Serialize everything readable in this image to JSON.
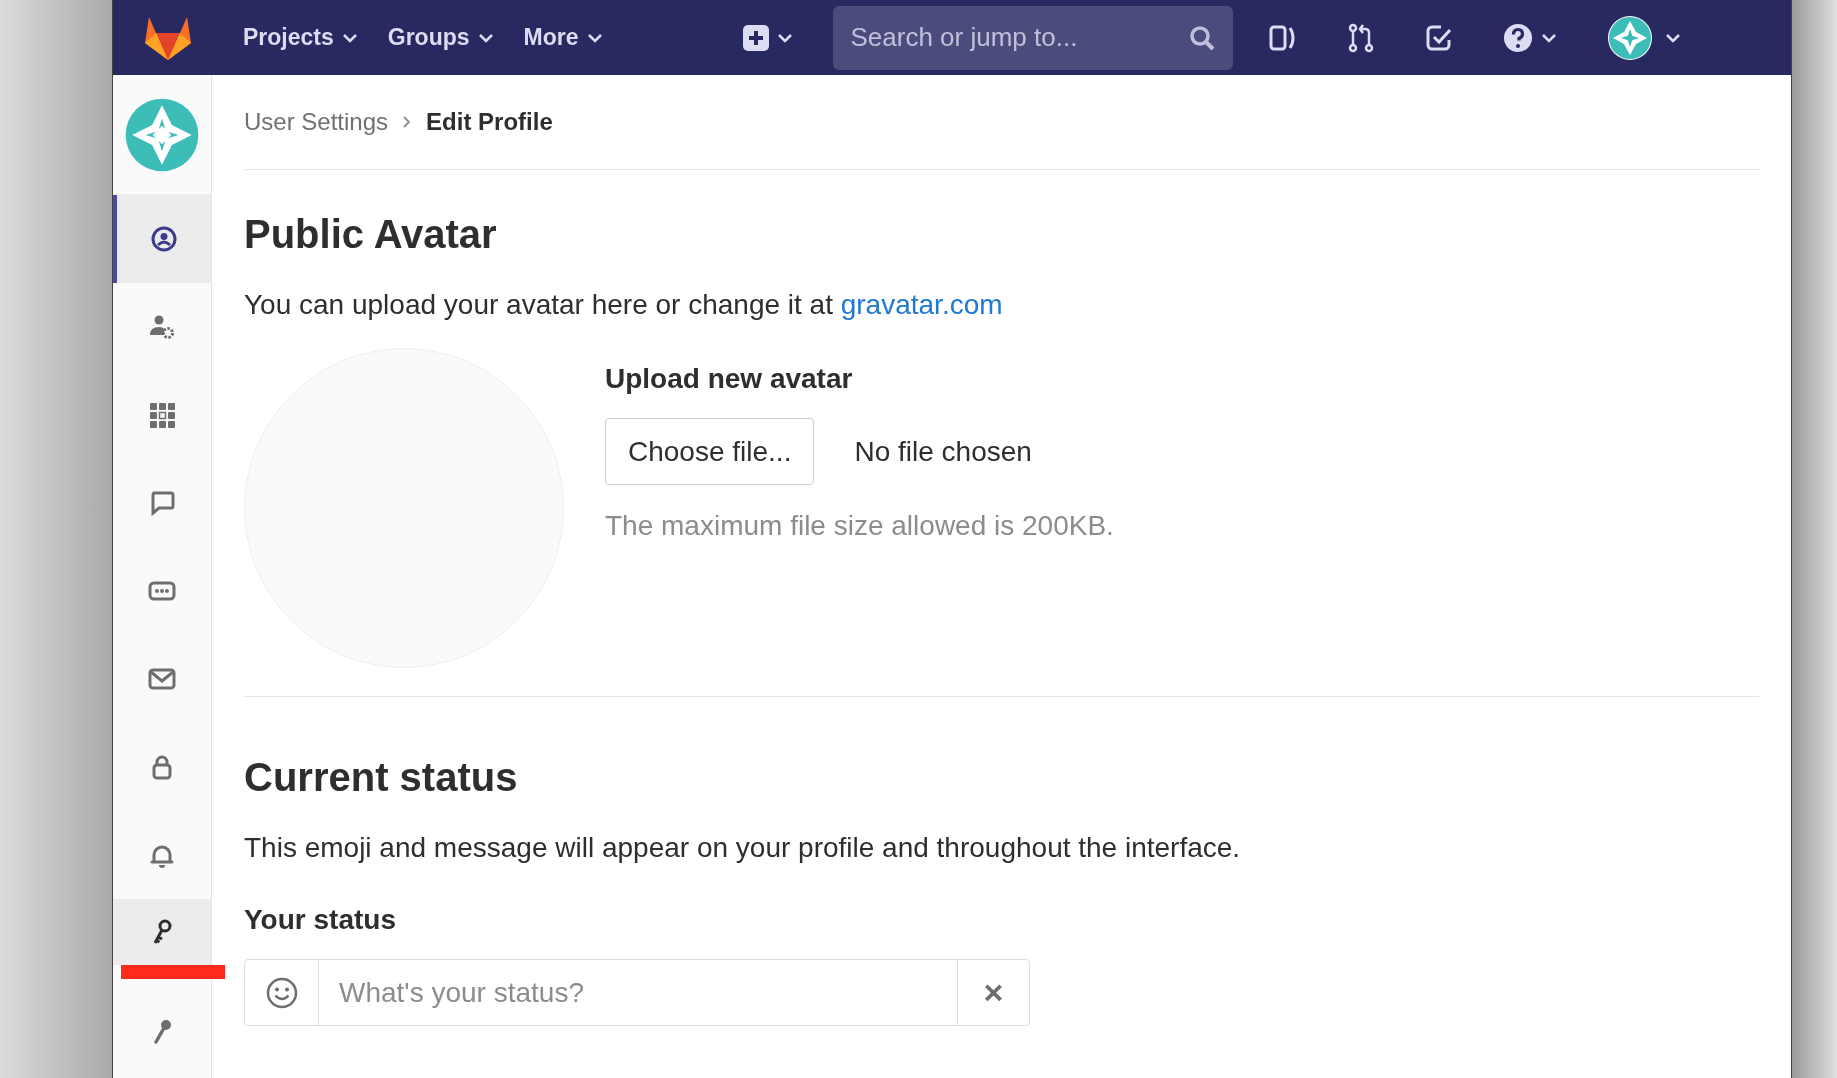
{
  "navbar": {
    "menus": [
      {
        "label": "Projects"
      },
      {
        "label": "Groups"
      },
      {
        "label": "More"
      }
    ],
    "search": {
      "placeholder": "Search or jump to..."
    }
  },
  "sidebar": {
    "items": [
      {
        "kind": "profile",
        "selected": true,
        "hovered": false
      },
      {
        "kind": "account",
        "selected": false,
        "hovered": false
      },
      {
        "kind": "applications",
        "selected": false,
        "hovered": false
      },
      {
        "kind": "chat",
        "selected": false,
        "hovered": false
      },
      {
        "kind": "tokens",
        "selected": false,
        "hovered": false
      },
      {
        "kind": "emails",
        "selected": false,
        "hovered": false
      },
      {
        "kind": "password",
        "selected": false,
        "hovered": false
      },
      {
        "kind": "notifications",
        "selected": false,
        "hovered": false
      },
      {
        "kind": "ssh-keys",
        "selected": false,
        "hovered": true
      },
      {
        "kind": "gpg-keys",
        "selected": false,
        "hovered": false
      }
    ]
  },
  "breadcrumb": [
    {
      "label": "User Settings",
      "current": false
    },
    {
      "label": "Edit Profile",
      "current": true
    }
  ],
  "avatar_section": {
    "title": "Public Avatar",
    "description": "You can upload your avatar here or change it at ",
    "link": "gravatar.com",
    "upload_label": "Upload new avatar",
    "button": "Choose file...",
    "file_status": "No file chosen",
    "hint": "The maximum file size allowed is 200KB."
  },
  "status_section": {
    "title": "Current status",
    "description": "This emoji and message will appear on your profile and throughout the interface.",
    "field_label": "Your status",
    "placeholder": "What's your status?",
    "clear": "×"
  }
}
